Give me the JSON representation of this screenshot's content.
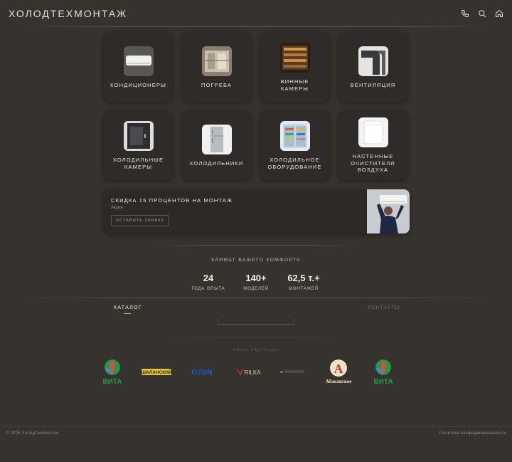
{
  "header": {
    "brand": "ХОЛОДТЕХМОНТАЖ",
    "icons": [
      "phone-icon",
      "search-icon",
      "home-icon"
    ]
  },
  "categories": [
    {
      "label": "КОНДИЦИОНЕРЫ",
      "image": "air-conditioner"
    },
    {
      "label": "ПОГРЕБА",
      "image": "cellar"
    },
    {
      "label": "ВИННЫЕ\nКАМЕРЫ",
      "image": "wine-cabinet"
    },
    {
      "label": "ВЕНТИЛЯЦИЯ",
      "image": "ventilation"
    },
    {
      "label": "ХОЛОДИЛЬНЫЕ\nКАМЕРЫ",
      "image": "cold-room"
    },
    {
      "label": "ХОЛОДИЛЬНИКИ",
      "image": "fridge"
    },
    {
      "label": "ХОЛОДИЛЬНОЕ\nОБОРУДОВАНИЕ",
      "image": "display-fridge"
    },
    {
      "label": "НАСТЕННЫЕ\nОЧИСТИТЕЛИ\nВОЗДУХА",
      "image": "air-purifier"
    }
  ],
  "promo": {
    "title": "СКИДКА 15 ПРОЦЕНТОВ НА МОНТАЖ",
    "subtitle": "Акция",
    "button": "ОСТАВИТЬ ЗАЯВКУ"
  },
  "tagline": "КЛИМАТ ВАШЕГО КОМФОРТА",
  "stats": [
    {
      "value": "24",
      "label": "ГОДА ОПЫТА"
    },
    {
      "value": "140+",
      "label": "МОДЕЛЕЙ"
    },
    {
      "value": "62,5 т.+",
      "label": "МОНТАЖЕЙ"
    }
  ],
  "nav": {
    "catalog": "КАТАЛОГ",
    "contacts": "КОНТАКТЫ"
  },
  "partners": {
    "title": "наши партнеры",
    "logos": [
      {
        "name": "ВИТА",
        "color": "#1f9a4a"
      },
      {
        "name": "ШАЛАНСКИЙ",
        "color": "#e2c23a"
      },
      {
        "name": "OZON",
        "color": "#1c5bd6"
      },
      {
        "name": "RILKA",
        "color": "#d9c9a8"
      },
      {
        "name": "unknown",
        "color": "#6c675f"
      },
      {
        "name": "Абаканское",
        "color": "#c0392b"
      },
      {
        "name": "ВИТА",
        "color": "#1f9a4a"
      }
    ]
  },
  "footer": {
    "copyright": "© 2026 ХолодТехМонтаж",
    "privacy": "Политика конфиденциальности"
  },
  "colors": {
    "background": "#36322e",
    "card": "#2e2b28",
    "accent": "#c9a874"
  }
}
